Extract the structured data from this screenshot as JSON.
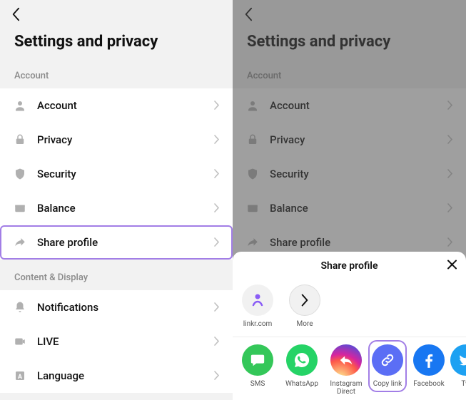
{
  "pageTitle": "Settings and privacy",
  "sections": {
    "account": {
      "header": "Account",
      "items": {
        "account": "Account",
        "privacy": "Privacy",
        "security": "Security",
        "balance": "Balance",
        "shareProfile": "Share profile"
      }
    },
    "content": {
      "header": "Content & Display",
      "items": {
        "notifications": "Notifications",
        "live": "LIVE",
        "language": "Language"
      }
    }
  },
  "shareSheet": {
    "title": "Share profile",
    "row1": {
      "linkr": "linkr.com",
      "more": "More"
    },
    "row2": {
      "sms": "SMS",
      "whatsapp": "WhatsApp",
      "instagram": "Instagram Direct",
      "copylink": "Copy link",
      "facebook": "Facebook",
      "twitter": "Tw"
    }
  }
}
